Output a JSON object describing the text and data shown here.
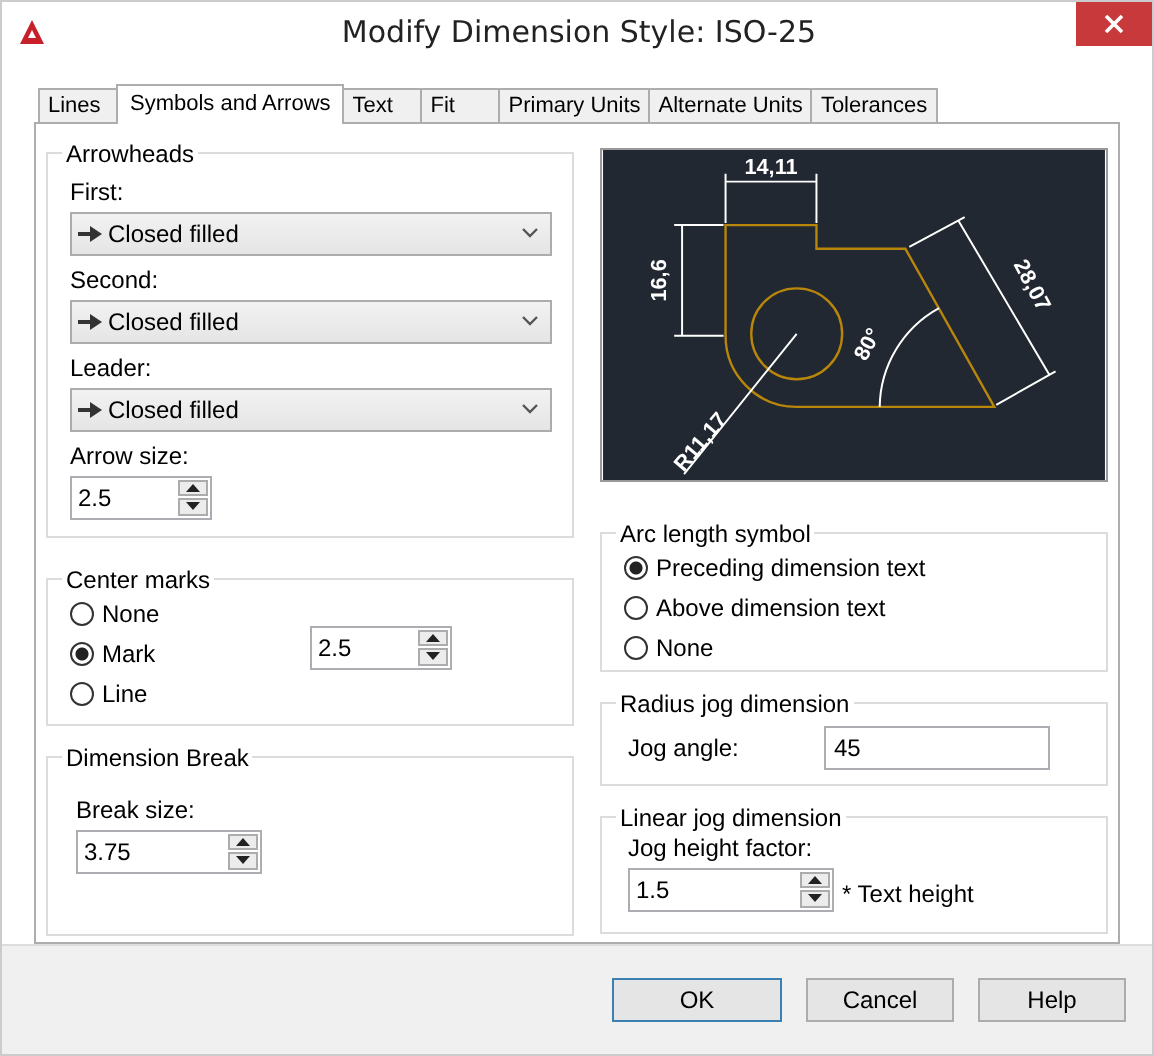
{
  "window": {
    "title": "Modify Dimension Style: ISO-25"
  },
  "tabs": [
    {
      "label": "Lines",
      "selected": false
    },
    {
      "label": "Symbols and Arrows",
      "selected": true
    },
    {
      "label": "Text",
      "selected": false
    },
    {
      "label": "Fit",
      "selected": false
    },
    {
      "label": "Primary Units",
      "selected": false
    },
    {
      "label": "Alternate Units",
      "selected": false
    },
    {
      "label": "Tolerances",
      "selected": false
    }
  ],
  "arrowheads": {
    "title": "Arrowheads",
    "fields": [
      {
        "label": "First:",
        "value": "Closed filled"
      },
      {
        "label": "Second:",
        "value": "Closed filled"
      },
      {
        "label": "Leader:",
        "value": "Closed filled"
      }
    ],
    "arrow_size": {
      "label": "Arrow size:",
      "value": "2.5"
    }
  },
  "center_marks": {
    "title": "Center marks",
    "options": [
      {
        "label": "None",
        "selected": false
      },
      {
        "label": "Mark",
        "selected": true
      },
      {
        "label": "Line",
        "selected": false
      }
    ],
    "size": "2.5"
  },
  "dimension_break": {
    "title": "Dimension Break",
    "label": "Break size:",
    "value": "3.75"
  },
  "preview": {
    "labels": [
      "14,11",
      "16,6",
      "28,07",
      "80°",
      "R11,17"
    ]
  },
  "arc_length": {
    "title": "Arc length symbol",
    "options": [
      {
        "label": "Preceding dimension text",
        "selected": true
      },
      {
        "label": "Above dimension text",
        "selected": false
      },
      {
        "label": "None",
        "selected": false
      }
    ]
  },
  "radius_jog": {
    "title": "Radius jog dimension",
    "label": "Jog angle:",
    "value": "45"
  },
  "linear_jog": {
    "title": "Linear jog dimension",
    "label": "Jog height factor:",
    "value": "1.5",
    "suffix": "* Text height"
  },
  "buttons": [
    "OK",
    "Cancel",
    "Help"
  ]
}
